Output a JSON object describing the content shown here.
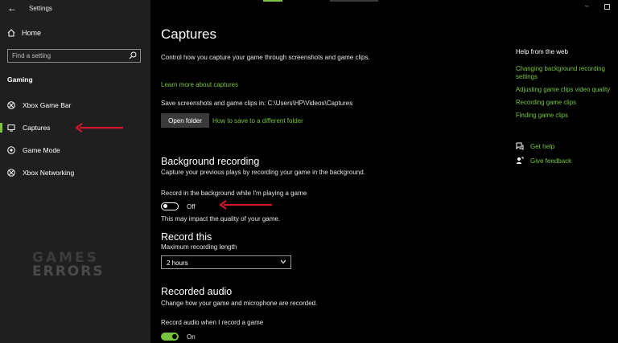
{
  "window": {
    "title": "Settings",
    "back_icon": "back-arrow-icon"
  },
  "sidebar": {
    "home_label": "Home",
    "search_placeholder": "Find a setting",
    "section_label": "Gaming",
    "items": [
      {
        "label": "Xbox Game Bar",
        "icon": "xbox-icon",
        "active": false
      },
      {
        "label": "Captures",
        "icon": "captures-icon",
        "active": true
      },
      {
        "label": "Game Mode",
        "icon": "game-mode-icon",
        "active": false
      },
      {
        "label": "Xbox Networking",
        "icon": "xbox-icon",
        "active": false
      }
    ],
    "watermark_line1": "GAMES",
    "watermark_line2": "ERRORS"
  },
  "main": {
    "title": "Captures",
    "description": "Control how you capture your game through screenshots and game clips.",
    "learn_more_link": "Learn more about captures",
    "save_location_label": "Save screenshots and game clips in: C:\\Users\\HP\\Videos\\Captures",
    "open_folder_button": "Open folder",
    "save_location_link": "How to save to a different folder",
    "background_recording": {
      "heading": "Background recording",
      "description": "Capture your previous plays by recording your game in the background.",
      "toggle_label": "Record in the background while I'm playing a game",
      "toggle_state": "Off",
      "note": "This may impact the quality of your game."
    },
    "record_this": {
      "heading": "Record this",
      "max_length_label": "Maximum recording length",
      "max_length_value": "2 hours"
    },
    "recorded_audio": {
      "heading": "Recorded audio",
      "description": "Change how your game and microphone are recorded.",
      "toggle_label": "Record audio when I record a game",
      "toggle_state": "On"
    }
  },
  "help_panel": {
    "title": "Help from the web",
    "links": [
      "Changing background recording settings",
      "Adjusting game clips video quality",
      "Recording game clips",
      "Finding game clips"
    ],
    "get_help": "Get help",
    "give_feedback": "Give feedback"
  },
  "colors": {
    "accent": "#78c43f",
    "annotation_arrow": "#d0192c",
    "sidebar_bg": "#1f1f1f",
    "main_bg": "#000000"
  }
}
